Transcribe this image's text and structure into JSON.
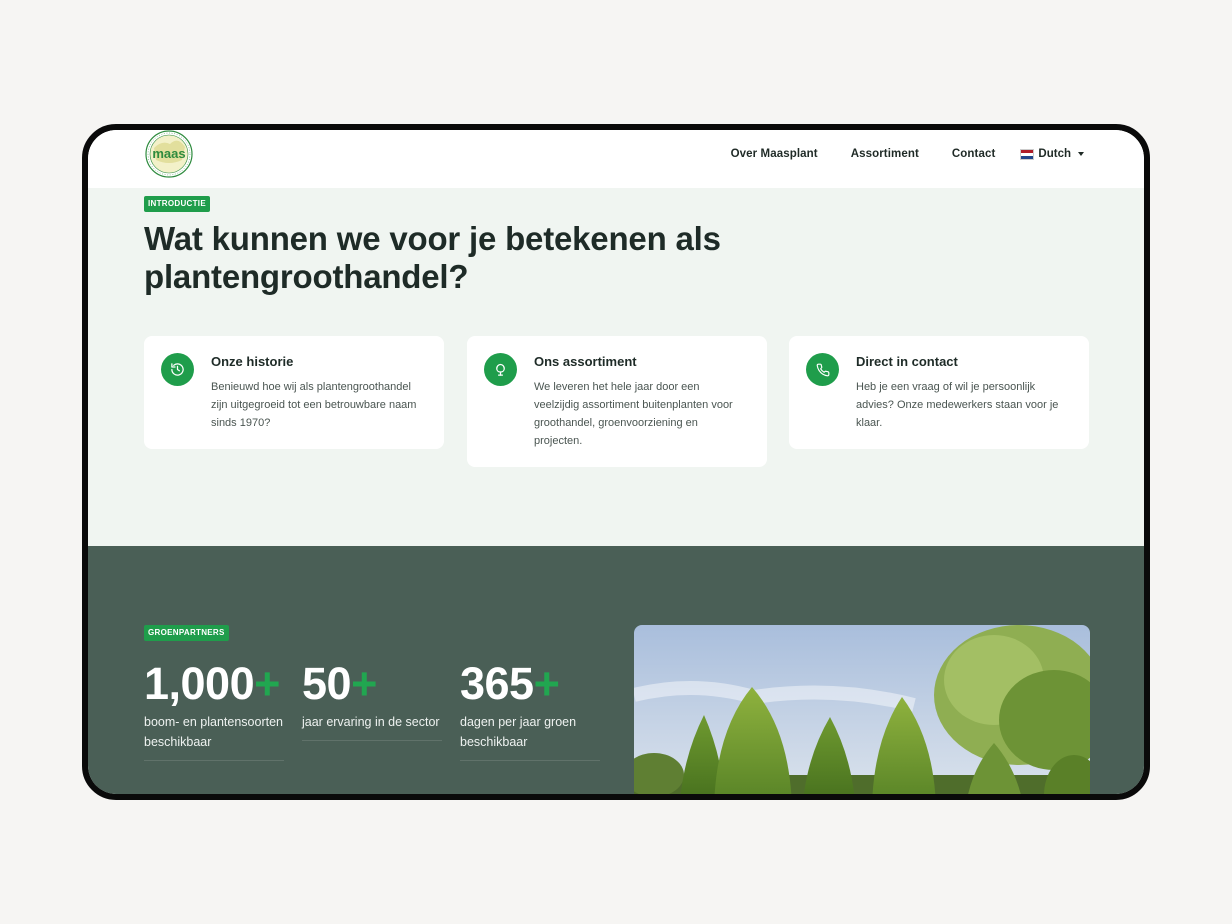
{
  "header": {
    "logo_text": "maas",
    "nav": [
      "Over Maasplant",
      "Assortiment",
      "Contact"
    ],
    "language": "Dutch"
  },
  "intro": {
    "tag": "INTRODUCTIE",
    "headline": "Wat kunnen we voor je betekenen als plantengroothandel?",
    "cards": [
      {
        "icon": "history-icon",
        "title": "Onze historie",
        "text": "Benieuwd hoe wij als plantengroothandel zijn uitgegroeid tot een betrouwbare naam sinds 1970?"
      },
      {
        "icon": "tree-icon",
        "title": "Ons assortiment",
        "text": "We leveren het hele jaar door een veelzijdig assortiment buitenplanten voor groothandel, groenvoorziening en projecten."
      },
      {
        "icon": "phone-icon",
        "title": "Direct in contact",
        "text": "Heb je een vraag of wil je persoonlijk advies? Onze medewerkers staan voor je klaar."
      }
    ]
  },
  "partners": {
    "tag": "GROENPARTNERS",
    "stats": [
      {
        "number": "1,000",
        "plus": "+",
        "label": "boom- en plantensoorten beschikbaar"
      },
      {
        "number": "50",
        "plus": "+",
        "label": "jaar ervaring in de sector"
      },
      {
        "number": "365",
        "plus": "+",
        "label": "dagen per jaar groen beschikbaar"
      }
    ]
  },
  "colors": {
    "brand_green": "#1f9d4b",
    "dark_section": "#4a5f56",
    "intro_bg": "#f0f5f1"
  }
}
